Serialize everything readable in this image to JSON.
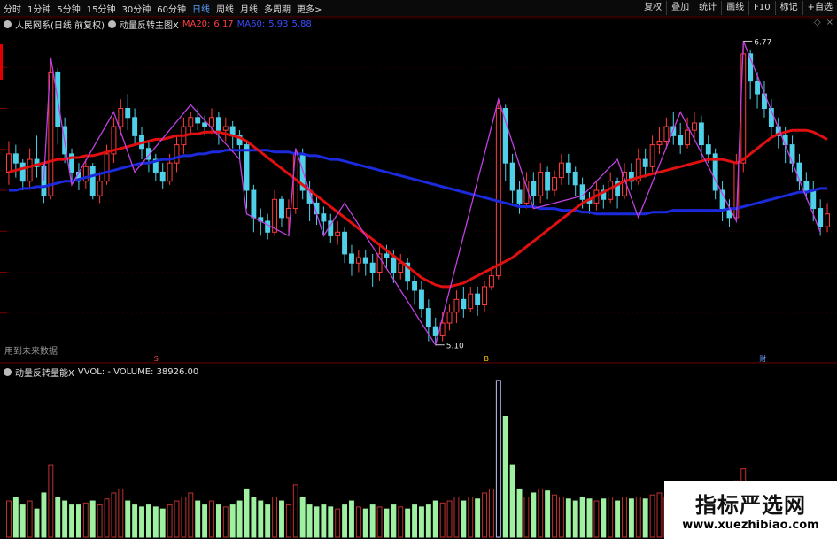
{
  "toolbar": {
    "periods": [
      "分时",
      "1分钟",
      "5分钟",
      "15分钟",
      "30分钟",
      "60分钟",
      "日线",
      "周线",
      "月线",
      "多周期",
      "更多>"
    ],
    "active_period": "日线",
    "tools": [
      "复权",
      "叠加",
      "统计",
      "画线",
      "F10",
      "标记",
      "+自选"
    ]
  },
  "legend": {
    "stock": "人民网系(日线 前复权)",
    "indicator": "动量反转主图X",
    "ma20_label": "MA20:",
    "ma20_value": "6.17",
    "ma60_label": "MA60:",
    "ma60_value": "5.93",
    "extra_value": "5.88"
  },
  "volume_legend": {
    "indicator": "动量反转量能X",
    "text": "VVOL: -  VOLUME: 38926.00"
  },
  "annotations": {
    "high": "6.77",
    "low": "5.10",
    "future": "用到未来数据",
    "marker_a": "S",
    "marker_b": "B",
    "marker_c": "财"
  },
  "watermark": {
    "title": "指标严选网",
    "url": "www.xuezhibiao.com"
  },
  "colors": {
    "up": "#ff3b3b",
    "down": "#4fd0e8",
    "ma20": "#e01010",
    "ma60": "#1a2adc",
    "zigzag": "#c040e0",
    "vol_up": "#c03030",
    "vol_down": "#9ff0a0",
    "vol_special": "#c0c0ff"
  },
  "chart_data": {
    "type": "candlestick",
    "ylim": [
      5.05,
      6.85
    ],
    "candles": [
      [
        6.05,
        6.15,
        6.22,
        5.98
      ],
      [
        6.15,
        6.1,
        6.2,
        6.02
      ],
      [
        6.1,
        6.0,
        6.12,
        5.95
      ],
      [
        6.0,
        6.12,
        6.18,
        5.96
      ],
      [
        6.12,
        6.08,
        6.25,
        6.02
      ],
      [
        6.08,
        5.92,
        6.1,
        5.88
      ],
      [
        5.92,
        6.6,
        6.68,
        5.9
      ],
      [
        6.6,
        6.3,
        6.62,
        6.2
      ],
      [
        6.3,
        6.15,
        6.35,
        6.1
      ],
      [
        6.15,
        6.05,
        6.18,
        5.98
      ],
      [
        6.05,
        6.0,
        6.1,
        5.95
      ],
      [
        6.0,
        6.08,
        6.12,
        5.96
      ],
      [
        6.08,
        5.92,
        6.1,
        5.9
      ],
      [
        5.92,
        6.0,
        6.05,
        5.88
      ],
      [
        6.0,
        6.15,
        6.2,
        5.98
      ],
      [
        6.15,
        6.3,
        6.35,
        6.1
      ],
      [
        6.3,
        6.4,
        6.45,
        6.25
      ],
      [
        6.4,
        6.35,
        6.48,
        6.28
      ],
      [
        6.35,
        6.25,
        6.4,
        6.2
      ],
      [
        6.25,
        6.18,
        6.3,
        6.12
      ],
      [
        6.18,
        6.12,
        6.22,
        6.05
      ],
      [
        6.12,
        6.05,
        6.15,
        6.0
      ],
      [
        6.05,
        6.0,
        6.1,
        5.96
      ],
      [
        6.0,
        6.1,
        6.15,
        5.98
      ],
      [
        6.1,
        6.2,
        6.25,
        6.05
      ],
      [
        6.2,
        6.3,
        6.35,
        6.15
      ],
      [
        6.3,
        6.35,
        6.38,
        6.25
      ],
      [
        6.35,
        6.32,
        6.4,
        6.28
      ],
      [
        6.32,
        6.3,
        6.36,
        6.25
      ],
      [
        6.3,
        6.35,
        6.4,
        6.26
      ],
      [
        6.35,
        6.28,
        6.38,
        6.2
      ],
      [
        6.28,
        6.3,
        6.35,
        6.22
      ],
      [
        6.3,
        6.25,
        6.33,
        6.18
      ],
      [
        6.25,
        6.2,
        6.28,
        6.12
      ],
      [
        6.2,
        5.95,
        6.22,
        5.85
      ],
      [
        5.95,
        5.8,
        5.98,
        5.72
      ],
      [
        5.8,
        5.78,
        5.85,
        5.7
      ],
      [
        5.78,
        5.72,
        5.82,
        5.68
      ],
      [
        5.72,
        5.9,
        5.95,
        5.7
      ],
      [
        5.9,
        5.8,
        5.92,
        5.75
      ],
      [
        5.8,
        5.85,
        5.9,
        5.7
      ],
      [
        5.85,
        6.15,
        6.18,
        5.82
      ],
      [
        6.15,
        5.95,
        6.18,
        5.9
      ],
      [
        5.95,
        5.88,
        6.0,
        5.78
      ],
      [
        5.88,
        5.82,
        5.92,
        5.76
      ],
      [
        5.82,
        5.78,
        5.86,
        5.7
      ],
      [
        5.78,
        5.7,
        5.82,
        5.66
      ],
      [
        5.7,
        5.72,
        5.78,
        5.65
      ],
      [
        5.72,
        5.6,
        5.75,
        5.55
      ],
      [
        5.6,
        5.55,
        5.65,
        5.48
      ],
      [
        5.55,
        5.58,
        5.62,
        5.5
      ],
      [
        5.58,
        5.55,
        5.62,
        5.48
      ],
      [
        5.55,
        5.5,
        5.6,
        5.42
      ],
      [
        5.5,
        5.6,
        5.65,
        5.45
      ],
      [
        5.6,
        5.58,
        5.65,
        5.52
      ],
      [
        5.58,
        5.5,
        5.62,
        5.44
      ],
      [
        5.5,
        5.55,
        5.6,
        5.46
      ],
      [
        5.55,
        5.45,
        5.58,
        5.4
      ],
      [
        5.45,
        5.4,
        5.48,
        5.32
      ],
      [
        5.4,
        5.3,
        5.45,
        5.25
      ],
      [
        5.3,
        5.2,
        5.35,
        5.12
      ],
      [
        5.2,
        5.15,
        5.25,
        5.1
      ],
      [
        5.15,
        5.22,
        5.28,
        5.12
      ],
      [
        5.22,
        5.28,
        5.32,
        5.18
      ],
      [
        5.28,
        5.35,
        5.4,
        5.22
      ],
      [
        5.35,
        5.3,
        5.42,
        5.25
      ],
      [
        5.3,
        5.38,
        5.42,
        5.28
      ],
      [
        5.38,
        5.32,
        5.42,
        5.26
      ],
      [
        5.32,
        5.42,
        5.45,
        5.28
      ],
      [
        5.42,
        5.48,
        5.52,
        5.4
      ],
      [
        5.48,
        6.4,
        6.45,
        5.46
      ],
      [
        6.4,
        6.1,
        6.42,
        6.0
      ],
      [
        6.1,
        5.95,
        6.15,
        5.88
      ],
      [
        5.95,
        5.88,
        6.0,
        5.82
      ],
      [
        5.88,
        6.0,
        6.05,
        5.85
      ],
      [
        6.0,
        5.92,
        6.05,
        5.86
      ],
      [
        5.92,
        6.05,
        6.1,
        5.88
      ],
      [
        6.05,
        5.95,
        6.08,
        5.9
      ],
      [
        5.95,
        6.02,
        6.06,
        5.92
      ],
      [
        6.02,
        6.1,
        6.15,
        5.98
      ],
      [
        6.1,
        6.05,
        6.15,
        5.98
      ],
      [
        6.05,
        5.98,
        6.08,
        5.92
      ],
      [
        5.98,
        5.9,
        6.02,
        5.85
      ],
      [
        5.9,
        5.88,
        5.94,
        5.82
      ],
      [
        5.88,
        5.95,
        6.0,
        5.84
      ],
      [
        5.95,
        5.9,
        5.98,
        5.85
      ],
      [
        5.9,
        6.0,
        6.05,
        5.88
      ],
      [
        6.0,
        5.92,
        6.02,
        5.85
      ],
      [
        5.92,
        6.05,
        6.1,
        5.9
      ],
      [
        6.05,
        6.0,
        6.1,
        5.95
      ],
      [
        6.0,
        6.12,
        6.18,
        5.98
      ],
      [
        6.12,
        6.08,
        6.18,
        6.02
      ],
      [
        6.08,
        6.2,
        6.25,
        6.05
      ],
      [
        6.2,
        6.22,
        6.3,
        6.15
      ],
      [
        6.22,
        6.3,
        6.35,
        6.18
      ],
      [
        6.3,
        6.25,
        6.38,
        6.2
      ],
      [
        6.25,
        6.2,
        6.32,
        6.15
      ],
      [
        6.2,
        6.28,
        6.35,
        6.18
      ],
      [
        6.28,
        6.32,
        6.38,
        6.22
      ],
      [
        6.32,
        6.2,
        6.36,
        6.12
      ],
      [
        6.2,
        6.15,
        6.25,
        6.1
      ],
      [
        6.15,
        5.95,
        6.18,
        5.9
      ],
      [
        5.95,
        5.85,
        6.0,
        5.78
      ],
      [
        5.85,
        5.8,
        5.9,
        5.75
      ],
      [
        5.8,
        6.1,
        6.15,
        5.78
      ],
      [
        6.1,
        6.7,
        6.77,
        6.05
      ],
      [
        6.7,
        6.55,
        6.72,
        6.45
      ],
      [
        6.55,
        6.48,
        6.6,
        6.4
      ],
      [
        6.48,
        6.4,
        6.55,
        6.35
      ],
      [
        6.4,
        6.3,
        6.45,
        6.25
      ],
      [
        6.3,
        6.25,
        6.35,
        6.18
      ],
      [
        6.25,
        6.2,
        6.3,
        6.1
      ],
      [
        6.2,
        6.1,
        6.25,
        6.05
      ],
      [
        6.1,
        6.0,
        6.15,
        5.95
      ],
      [
        6.0,
        5.95,
        6.05,
        5.9
      ],
      [
        5.95,
        5.85,
        6.0,
        5.78
      ],
      [
        5.85,
        5.75,
        5.9,
        5.7
      ],
      [
        5.75,
        5.82,
        5.88,
        5.72
      ]
    ],
    "volume_ylim": [
      0,
      40000
    ],
    "volume": [
      9000,
      10000,
      8000,
      9000,
      7000,
      11000,
      18000,
      10000,
      9000,
      8000,
      8000,
      8500,
      9000,
      8000,
      9500,
      11000,
      12000,
      9000,
      8000,
      7500,
      8000,
      7500,
      7000,
      8000,
      9000,
      10000,
      11000,
      9000,
      8000,
      9000,
      8000,
      7500,
      8000,
      9000,
      12000,
      10000,
      9000,
      8000,
      10000,
      9000,
      8000,
      13000,
      10000,
      8000,
      7500,
      8000,
      7500,
      7000,
      8000,
      9000,
      7500,
      7000,
      8000,
      7500,
      7000,
      8000,
      7500,
      7000,
      8000,
      7500,
      8000,
      9000,
      8500,
      9000,
      10000,
      9000,
      10000,
      9500,
      11000,
      12000,
      38926,
      30000,
      18000,
      12000,
      10000,
      11000,
      12000,
      11500,
      10500,
      10000,
      9500,
      9000,
      10000,
      9500,
      9000,
      9500,
      10000,
      9000,
      10000,
      9500,
      10000,
      9500,
      10500,
      11000,
      10000,
      9500,
      9000,
      10000,
      10500,
      11000,
      10000,
      9500,
      9000,
      8500,
      14000,
      17000,
      13000,
      12000,
      11000,
      10500,
      10000,
      13000,
      12000,
      11000,
      10000,
      9500,
      9000,
      8000
    ],
    "ma20": [
      6.05,
      6.06,
      6.07,
      6.08,
      6.09,
      6.1,
      6.11,
      6.12,
      6.12,
      6.13,
      6.13,
      6.14,
      6.14,
      6.15,
      6.16,
      6.17,
      6.18,
      6.19,
      6.2,
      6.21,
      6.22,
      6.23,
      6.23,
      6.24,
      6.25,
      6.25,
      6.26,
      6.26,
      6.27,
      6.27,
      6.27,
      6.26,
      6.25,
      6.24,
      6.22,
      6.19,
      6.16,
      6.13,
      6.1,
      6.07,
      6.04,
      6.01,
      5.98,
      5.95,
      5.92,
      5.89,
      5.86,
      5.83,
      5.8,
      5.77,
      5.74,
      5.71,
      5.68,
      5.65,
      5.62,
      5.59,
      5.56,
      5.53,
      5.5,
      5.47,
      5.45,
      5.43,
      5.42,
      5.42,
      5.43,
      5.44,
      5.46,
      5.48,
      5.5,
      5.52,
      5.54,
      5.56,
      5.58,
      5.61,
      5.64,
      5.67,
      5.7,
      5.73,
      5.76,
      5.79,
      5.82,
      5.85,
      5.88,
      5.9,
      5.92,
      5.94,
      5.96,
      5.98,
      6.0,
      6.01,
      6.02,
      6.03,
      6.04,
      6.05,
      6.06,
      6.07,
      6.08,
      6.09,
      6.1,
      6.11,
      6.12,
      6.12,
      6.12,
      6.11,
      6.1,
      6.12,
      6.15,
      6.18,
      6.21,
      6.24,
      6.26,
      6.27,
      6.28,
      6.28,
      6.28,
      6.27,
      6.25,
      6.23
    ],
    "ma60": [
      5.95,
      5.95,
      5.96,
      5.96,
      5.97,
      5.97,
      5.98,
      5.99,
      6.0,
      6.0,
      6.01,
      6.02,
      6.03,
      6.04,
      6.05,
      6.06,
      6.07,
      6.08,
      6.09,
      6.1,
      6.1,
      6.11,
      6.12,
      6.12,
      6.13,
      6.14,
      6.14,
      6.15,
      6.15,
      6.16,
      6.16,
      6.17,
      6.17,
      6.17,
      6.17,
      6.17,
      6.17,
      6.17,
      6.16,
      6.16,
      6.16,
      6.15,
      6.15,
      6.14,
      6.14,
      6.13,
      6.12,
      6.12,
      6.11,
      6.1,
      6.09,
      6.08,
      6.07,
      6.06,
      6.05,
      6.04,
      6.03,
      6.02,
      6.01,
      6.0,
      5.99,
      5.98,
      5.97,
      5.96,
      5.95,
      5.94,
      5.93,
      5.92,
      5.91,
      5.9,
      5.89,
      5.88,
      5.87,
      5.86,
      5.86,
      5.86,
      5.85,
      5.85,
      5.85,
      5.84,
      5.84,
      5.84,
      5.83,
      5.83,
      5.82,
      5.82,
      5.82,
      5.82,
      5.82,
      5.82,
      5.82,
      5.82,
      5.83,
      5.83,
      5.83,
      5.84,
      5.84,
      5.84,
      5.84,
      5.84,
      5.84,
      5.84,
      5.84,
      5.85,
      5.85,
      5.86,
      5.87,
      5.88,
      5.89,
      5.9,
      5.91,
      5.92,
      5.93,
      5.94,
      5.94,
      5.95,
      5.96,
      5.96
    ],
    "zigzag": [
      [
        5,
        6.0
      ],
      [
        6,
        6.68
      ],
      [
        9,
        5.98
      ],
      [
        15,
        6.38
      ],
      [
        18,
        6.05
      ],
      [
        26,
        6.42
      ],
      [
        33,
        6.12
      ],
      [
        34,
        5.82
      ],
      [
        40,
        5.7
      ],
      [
        41,
        6.18
      ],
      [
        45,
        5.7
      ],
      [
        48,
        5.88
      ],
      [
        61,
        5.1
      ],
      [
        70,
        6.45
      ],
      [
        75,
        5.85
      ],
      [
        82,
        5.92
      ],
      [
        87,
        6.12
      ],
      [
        90,
        5.8
      ],
      [
        96,
        6.38
      ],
      [
        104,
        5.78
      ],
      [
        105,
        6.77
      ],
      [
        116,
        5.72
      ]
    ]
  }
}
